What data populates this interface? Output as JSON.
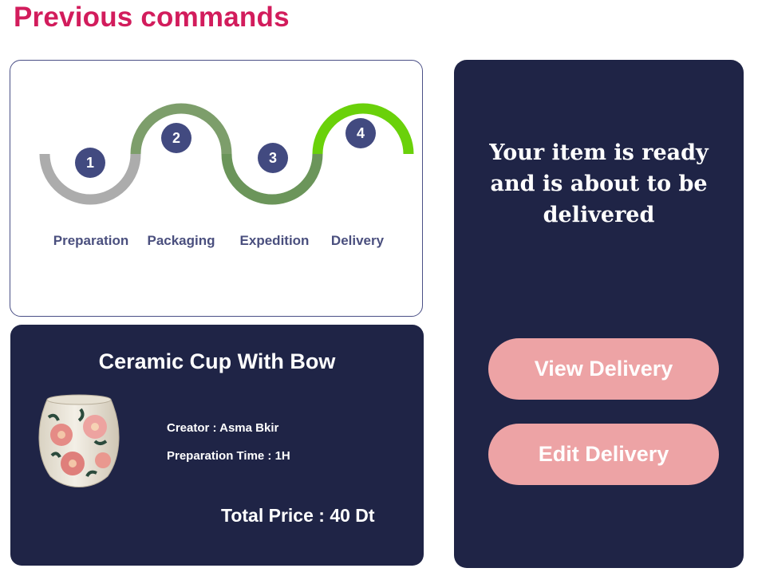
{
  "page": {
    "title": "Previous commands"
  },
  "progress": {
    "current_step": 4,
    "steps": [
      {
        "number": "1",
        "label": "Preparation"
      },
      {
        "number": "2",
        "label": "Packaging"
      },
      {
        "number": "3",
        "label": "Expedition"
      },
      {
        "number": "4",
        "label": "Delivery"
      }
    ],
    "colors": {
      "step1": "#acacac",
      "step2": "#7d9e6b",
      "step3": "#6b955a",
      "step4": "#6ad10a",
      "badge": "#424a80"
    }
  },
  "product": {
    "name": "Ceramic Cup With Bow",
    "image_icon": "ceramic-cup-photo",
    "creator": "Creator : Asma Bkir",
    "preparation_time": "Preparation Time : 1H",
    "total_price": "Total Price : 40 Dt"
  },
  "status": {
    "message": "Your item is ready and is about to be delivered",
    "buttons": {
      "view": "View Delivery",
      "edit": "Edit Delivery"
    }
  }
}
